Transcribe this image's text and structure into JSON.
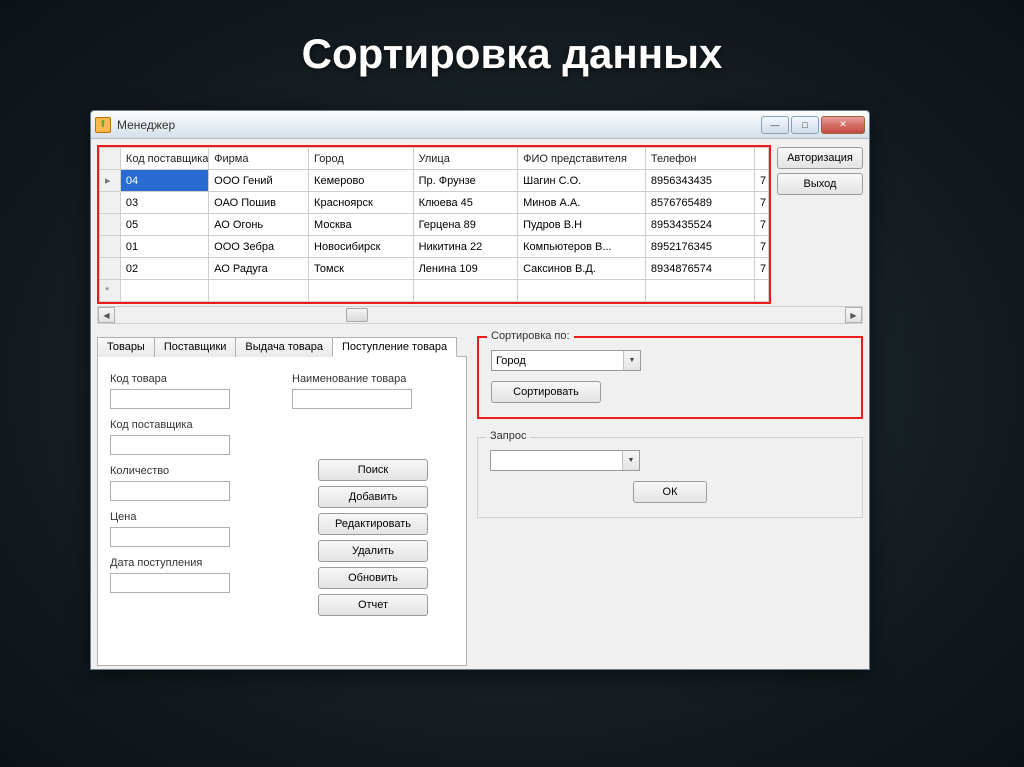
{
  "slide_title": "Сортировка данных",
  "window": {
    "title": "Менеджер",
    "buttons": {
      "auth": "Авторизация",
      "exit": "Выход"
    }
  },
  "grid": {
    "headers": [
      "Код поставщика",
      "Фирма",
      "Город",
      "Улица",
      "ФИО представителя",
      "Телефон"
    ],
    "rows": [
      {
        "code": "04",
        "firm": "ООО Гений",
        "city": "Кемерово",
        "street": "Пр. Фрунзе",
        "rep": "Шагин С.О.",
        "phone": "8956343435"
      },
      {
        "code": "03",
        "firm": "ОАО Пошив",
        "city": "Красноярск",
        "street": "Клюева 45",
        "rep": "Минов А.А.",
        "phone": "8576765489"
      },
      {
        "code": "05",
        "firm": "АО Огонь",
        "city": "Москва",
        "street": "Герцена 89",
        "rep": "Пудров В.Н",
        "phone": "8953435524"
      },
      {
        "code": "01",
        "firm": "ООО Зебра",
        "city": "Новосибирск",
        "street": "Никитина 22",
        "rep": "Компьютеров В...",
        "phone": "8952176345"
      },
      {
        "code": "02",
        "firm": "АО Радуга",
        "city": "Томск",
        "street": "Ленина 109",
        "rep": "Саксинов В.Д.",
        "phone": "8934876574"
      }
    ],
    "selected_row": 0,
    "row_marker": "▸",
    "new_marker": "*"
  },
  "tabs": {
    "items": [
      "Товары",
      "Поставщики",
      "Выдача товара",
      "Поступление товара"
    ],
    "active": 3,
    "labels": {
      "code": "Код товара",
      "name": "Наименование товара",
      "supplier": "Код поставщика",
      "qty": "Количество",
      "price": "Цена",
      "date": "Дата поступления"
    },
    "actions": {
      "search": "Поиск",
      "add": "Добавить",
      "edit": "Редактировать",
      "delete": "Удалить",
      "refresh": "Обновить",
      "report": "Отчет"
    }
  },
  "sort": {
    "legend": "Сортировка по:",
    "value": "Город",
    "button": "Сортировать"
  },
  "query": {
    "legend": "Запрос",
    "value": "",
    "ok": "ОК"
  }
}
